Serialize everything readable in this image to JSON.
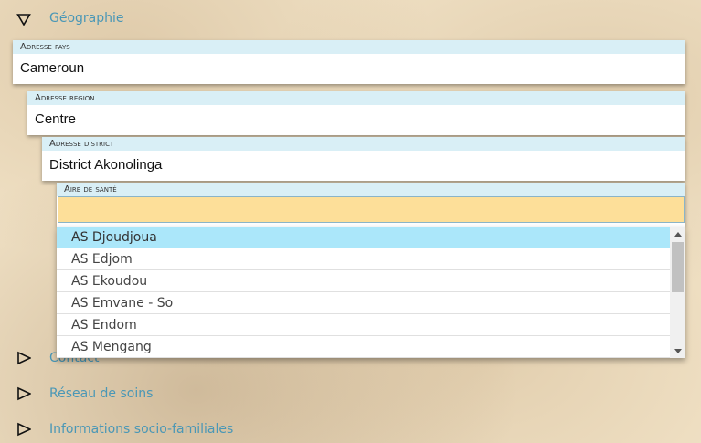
{
  "sections": {
    "geographie": "Géographie",
    "contact": "Contact",
    "reseau": "Réseau de soins",
    "socio": "Informations socio-familiales"
  },
  "fields": {
    "pays": {
      "label": "Adresse pays",
      "value": "Cameroun"
    },
    "region": {
      "label": "Adresse region",
      "value": "Centre"
    },
    "district": {
      "label": "Adresse district",
      "value": "District Akonolinga"
    },
    "aire": {
      "label": "Aire de santé",
      "value": ""
    }
  },
  "dropdown": {
    "options": [
      "AS Djoudjoua",
      "AS Edjom",
      "AS Ekoudou",
      "AS Emvane - So",
      "AS Endom",
      "AS Mengang"
    ],
    "selected": "AS Djoudjoua"
  },
  "icons": {
    "expanded": "triangle-down-icon",
    "collapsed": "triangle-right-icon",
    "scroll_up": "arrow-up-icon",
    "scroll_down": "arrow-down-icon"
  },
  "colors": {
    "section_text": "#4a97b6",
    "label_bg": "#d9eff6",
    "input_active": "#fddf99",
    "option_selected": "#abe7fa"
  }
}
